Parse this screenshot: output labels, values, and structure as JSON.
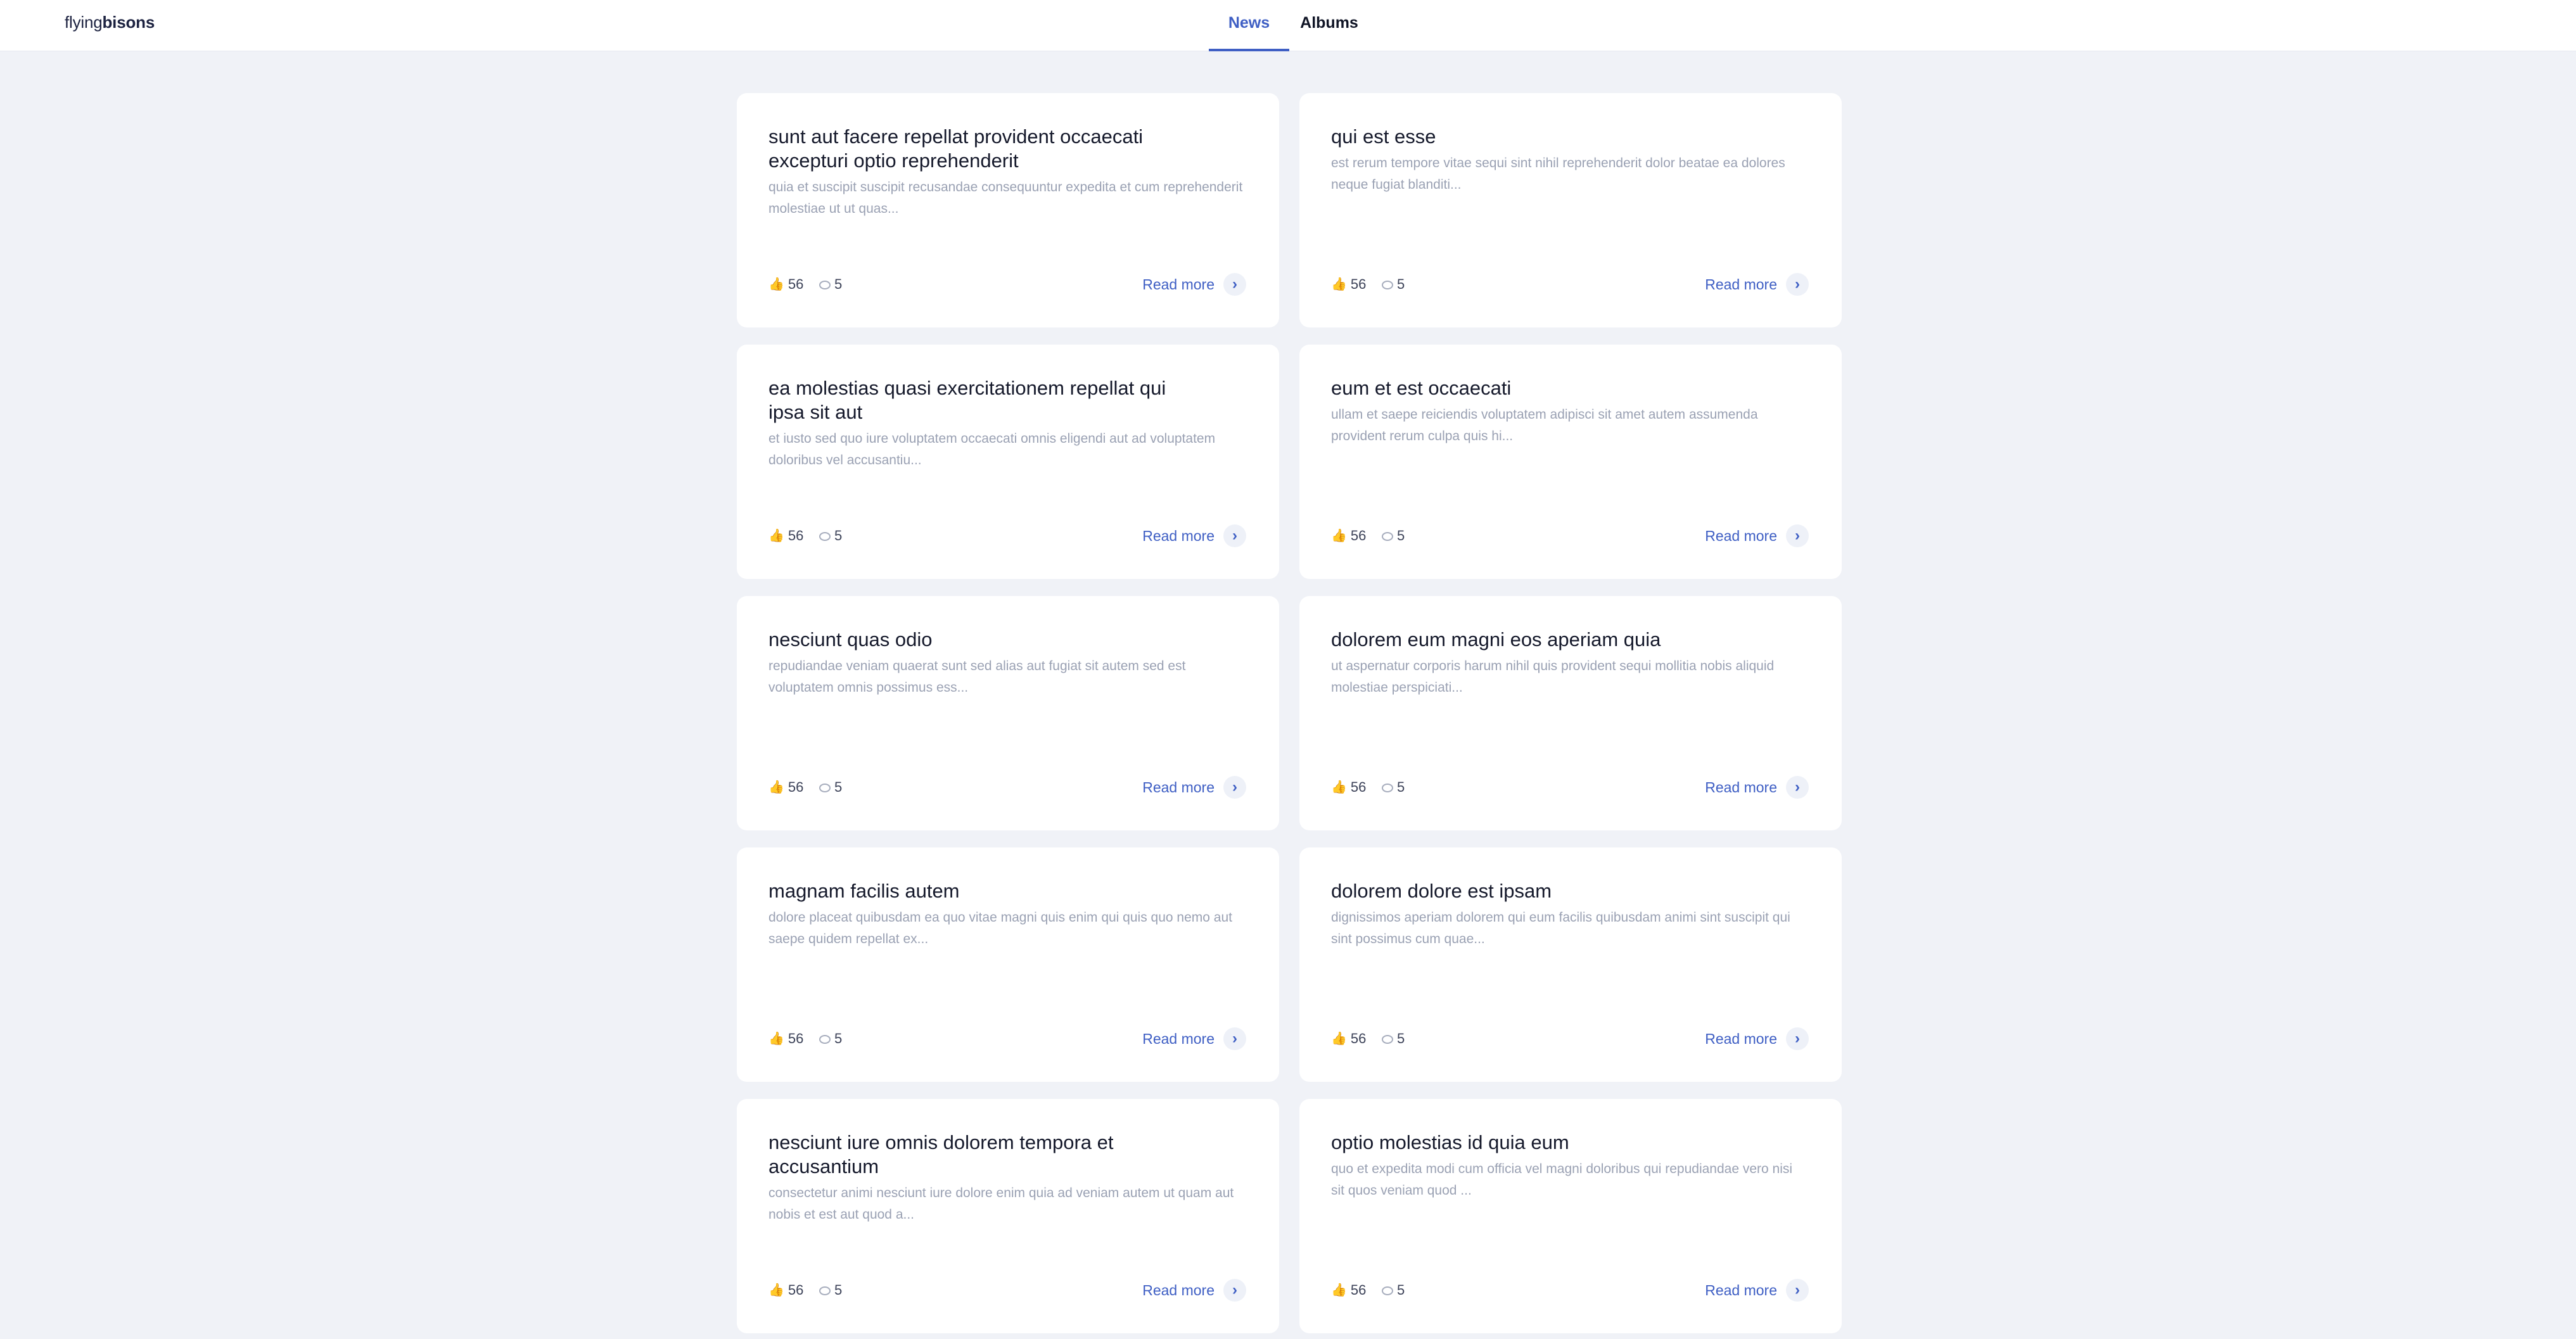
{
  "header": {
    "logo_light": "flying",
    "logo_bold": "bisons",
    "tabs": [
      {
        "label": "News",
        "active": true
      },
      {
        "label": "Albums",
        "active": false
      }
    ]
  },
  "colors": {
    "accent": "#3f5fc4",
    "background": "#f0f2f7",
    "card": "#ffffff",
    "like_icon": "#f3a51f"
  },
  "posts": [
    {
      "title": "sunt aut facere repellat provident occaecati excepturi optio reprehenderit",
      "body": "quia et suscipit suscipit recusandae consequuntur expedita et cum reprehenderit molestiae ut ut quas...",
      "likes": "56",
      "comments": "5",
      "read_more": "Read more"
    },
    {
      "title": "qui est esse",
      "body": "est rerum tempore vitae sequi sint nihil reprehenderit dolor beatae ea dolores neque fugiat blanditi...",
      "likes": "56",
      "comments": "5",
      "read_more": "Read more"
    },
    {
      "title": "ea molestias quasi exercitationem repellat qui ipsa sit aut",
      "body": "et iusto sed quo iure voluptatem occaecati omnis eligendi aut ad voluptatem doloribus vel accusantiu...",
      "likes": "56",
      "comments": "5",
      "read_more": "Read more"
    },
    {
      "title": "eum et est occaecati",
      "body": "ullam et saepe reiciendis voluptatem adipisci sit amet autem assumenda provident rerum culpa quis hi...",
      "likes": "56",
      "comments": "5",
      "read_more": "Read more"
    },
    {
      "title": "nesciunt quas odio",
      "body": "repudiandae veniam quaerat sunt sed alias aut fugiat sit autem sed est voluptatem omnis possimus ess...",
      "likes": "56",
      "comments": "5",
      "read_more": "Read more"
    },
    {
      "title": "dolorem eum magni eos aperiam quia",
      "body": "ut aspernatur corporis harum nihil quis provident sequi mollitia nobis aliquid molestiae perspiciati...",
      "likes": "56",
      "comments": "5",
      "read_more": "Read more"
    },
    {
      "title": "magnam facilis autem",
      "body": "dolore placeat quibusdam ea quo vitae magni quis enim qui quis quo nemo aut saepe quidem repellat ex...",
      "likes": "56",
      "comments": "5",
      "read_more": "Read more"
    },
    {
      "title": "dolorem dolore est ipsam",
      "body": "dignissimos aperiam dolorem qui eum facilis quibusdam animi sint suscipit qui sint possimus cum quae...",
      "likes": "56",
      "comments": "5",
      "read_more": "Read more"
    },
    {
      "title": "nesciunt iure omnis dolorem tempora et accusantium",
      "body": "consectetur animi nesciunt iure dolore enim quia ad veniam autem ut quam aut nobis et est aut quod a...",
      "likes": "56",
      "comments": "5",
      "read_more": "Read more"
    },
    {
      "title": "optio molestias id quia eum",
      "body": "quo et expedita modi cum officia vel magni doloribus qui repudiandae vero nisi sit quos veniam quod ...",
      "likes": "56",
      "comments": "5",
      "read_more": "Read more"
    }
  ]
}
